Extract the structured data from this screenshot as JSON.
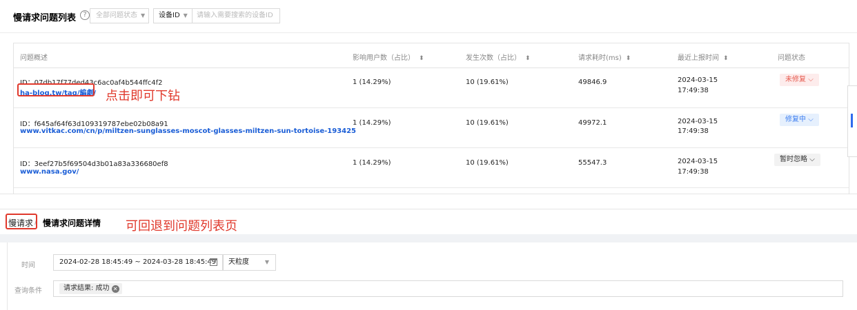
{
  "list": {
    "title": "慢请求问题列表",
    "help_icon": "help-circle-icon",
    "status_filter": "全部问题状态",
    "device_label": "设备ID",
    "device_placeholder": "请输入需要搜索的设备ID",
    "columns": [
      "问题概述",
      "影响用户数（占比）",
      "发生次数（占比）",
      "请求耗时(ms)",
      "最近上报时间",
      "问题状态"
    ],
    "rows": [
      {
        "id": "ID：07db17f77ded43c6ac0af4b544ffc4f2",
        "url": "ha-blog.tw/tag/編劇/",
        "users": "1 (14.29%)",
        "count": "10 (19.61%)",
        "ms": "49846.9",
        "date": "2024-03-15",
        "time": "17:49:38",
        "status": "未修复"
      },
      {
        "id": "ID：f645af64f63d109319787ebe02b08a91",
        "url": "www.vitkac.com/cn/p/miltzen-sunglasses-moscot-glasses-miltzen-sun-tortoise-193425",
        "users": "1 (14.29%)",
        "count": "10 (19.61%)",
        "ms": "49972.1",
        "date": "2024-03-15",
        "time": "17:49:38",
        "status": "修复中"
      },
      {
        "id": "ID：3eef27b5f69504d3b01a83a336680ef8",
        "url": "www.nasa.gov/",
        "users": "1 (14.29%)",
        "count": "10 (19.61%)",
        "ms": "55547.3",
        "date": "2024-03-15",
        "time": "17:49:38",
        "status": "暂时忽略"
      }
    ],
    "annotation": "点击即可下钻"
  },
  "detail": {
    "back_crumb": "慢请求",
    "separator": "/",
    "current": "慢请求问题详情",
    "annotation": "可回退到问题列表页",
    "time_label": "时间",
    "date_range": "2024-02-28 18:45:49  ~ 2024-03-28 18:45:49",
    "calendar_icon": "calendar-icon",
    "granularity": "天粒度",
    "cond_label": "查询条件",
    "chip": "请求结果: 成功"
  },
  "colors": {
    "accent": "#1a5dd6",
    "annotation": "#e0382b"
  }
}
